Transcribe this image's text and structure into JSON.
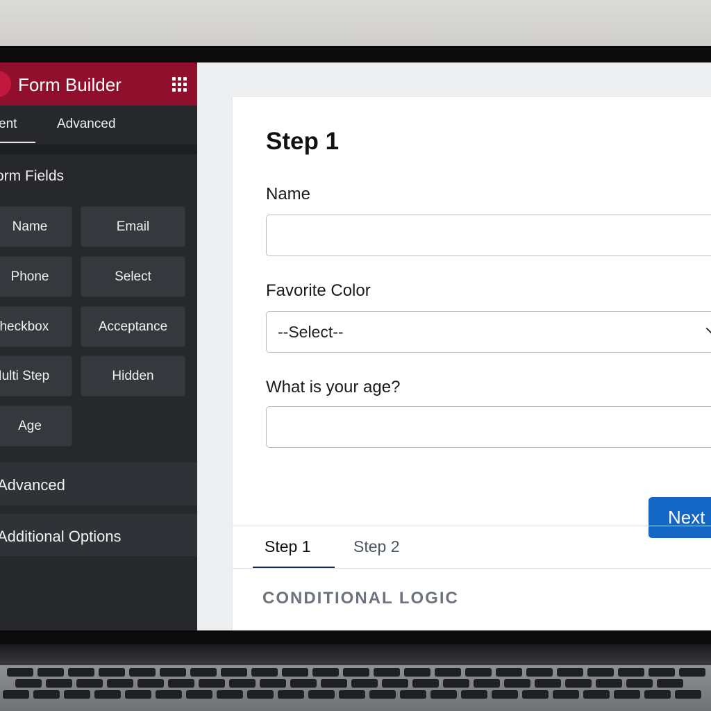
{
  "sidebar": {
    "title": "Form Builder",
    "tabs": [
      {
        "label": "Content",
        "visible_label": "ent"
      },
      {
        "label": "Advanced"
      }
    ],
    "section_title": "orm Fields",
    "fields": [
      {
        "label": "Name"
      },
      {
        "label": "Email"
      },
      {
        "label": "Phone"
      },
      {
        "label": "Select"
      },
      {
        "label": "Checkbox"
      },
      {
        "label": "Acceptance"
      },
      {
        "label": "Multi Step"
      },
      {
        "label": "Hidden"
      },
      {
        "label": "Age"
      }
    ],
    "panels": [
      {
        "label": "Advanced"
      },
      {
        "label": "Additional Options"
      }
    ]
  },
  "form": {
    "step_title": "Step 1",
    "fields": [
      {
        "label": "Name",
        "value": ""
      },
      {
        "label": "Favorite Color",
        "value": "--Select--"
      },
      {
        "label": "What is your age?",
        "value": ""
      }
    ],
    "next_label": "Next",
    "step_tabs": [
      {
        "label": "Step 1",
        "active": true
      },
      {
        "label": "Step 2",
        "active": false
      }
    ],
    "conditional_logic_label": "CONDITIONAL LOGIC"
  },
  "colors": {
    "brand": "#8f0f2c",
    "sidebar_bg": "#26282b",
    "button_bg": "#35383c",
    "primary": "#1366c4"
  },
  "icons": [
    "apps-grid-icon",
    "chevron-down-icon"
  ]
}
